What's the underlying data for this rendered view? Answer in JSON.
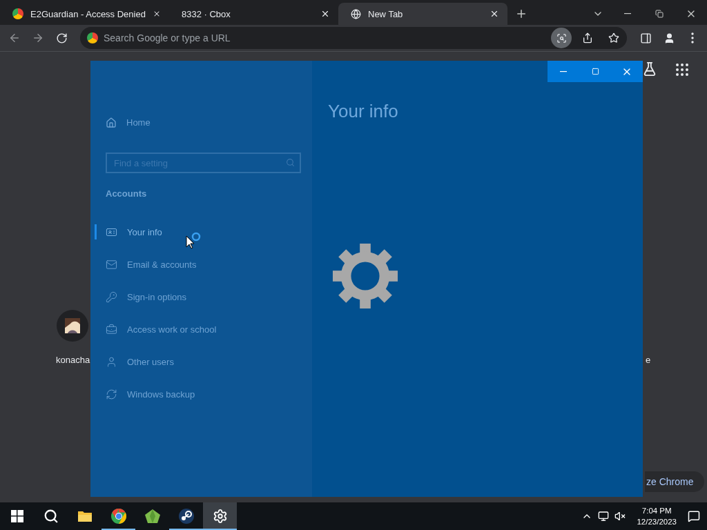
{
  "browser": {
    "tabs": [
      {
        "title": "E2Guardian - Access Denied",
        "selected": false
      },
      {
        "title": "8332 · Cbox",
        "selected": false
      },
      {
        "title": "New Tab",
        "selected": true
      }
    ],
    "omnibox": {
      "placeholder": "Search Google or type a URL"
    }
  },
  "new_tab_page": {
    "shortcuts": [
      {
        "label": "konacha"
      },
      {
        "label": "e"
      }
    ],
    "customize_button": "ze Chrome"
  },
  "settings_window": {
    "sidebar": {
      "home": "Home",
      "search": {
        "placeholder": "Find a setting"
      },
      "section": "Accounts",
      "items": [
        {
          "label": "Your info",
          "kind": "info",
          "selected": true
        },
        {
          "label": "Email & accounts",
          "kind": "email",
          "selected": false
        },
        {
          "label": "Sign-in options",
          "kind": "key",
          "selected": false
        },
        {
          "label": "Access work or school",
          "kind": "work",
          "selected": false
        },
        {
          "label": "Other users",
          "kind": "users",
          "selected": false
        },
        {
          "label": "Windows backup",
          "kind": "backup",
          "selected": false
        }
      ]
    },
    "page_title": "Your info"
  },
  "taskbar": {
    "apps": [
      {
        "kind": "search",
        "running": false,
        "active": false
      },
      {
        "kind": "explorer",
        "running": false,
        "active": false
      },
      {
        "kind": "chrome",
        "running": true,
        "active": false
      },
      {
        "kind": "gem",
        "running": false,
        "active": false
      },
      {
        "kind": "steam",
        "running": true,
        "active": false
      },
      {
        "kind": "settings",
        "running": true,
        "active": true
      }
    ],
    "clock": {
      "time": "7:04 PM",
      "date": "12/23/2023"
    }
  }
}
